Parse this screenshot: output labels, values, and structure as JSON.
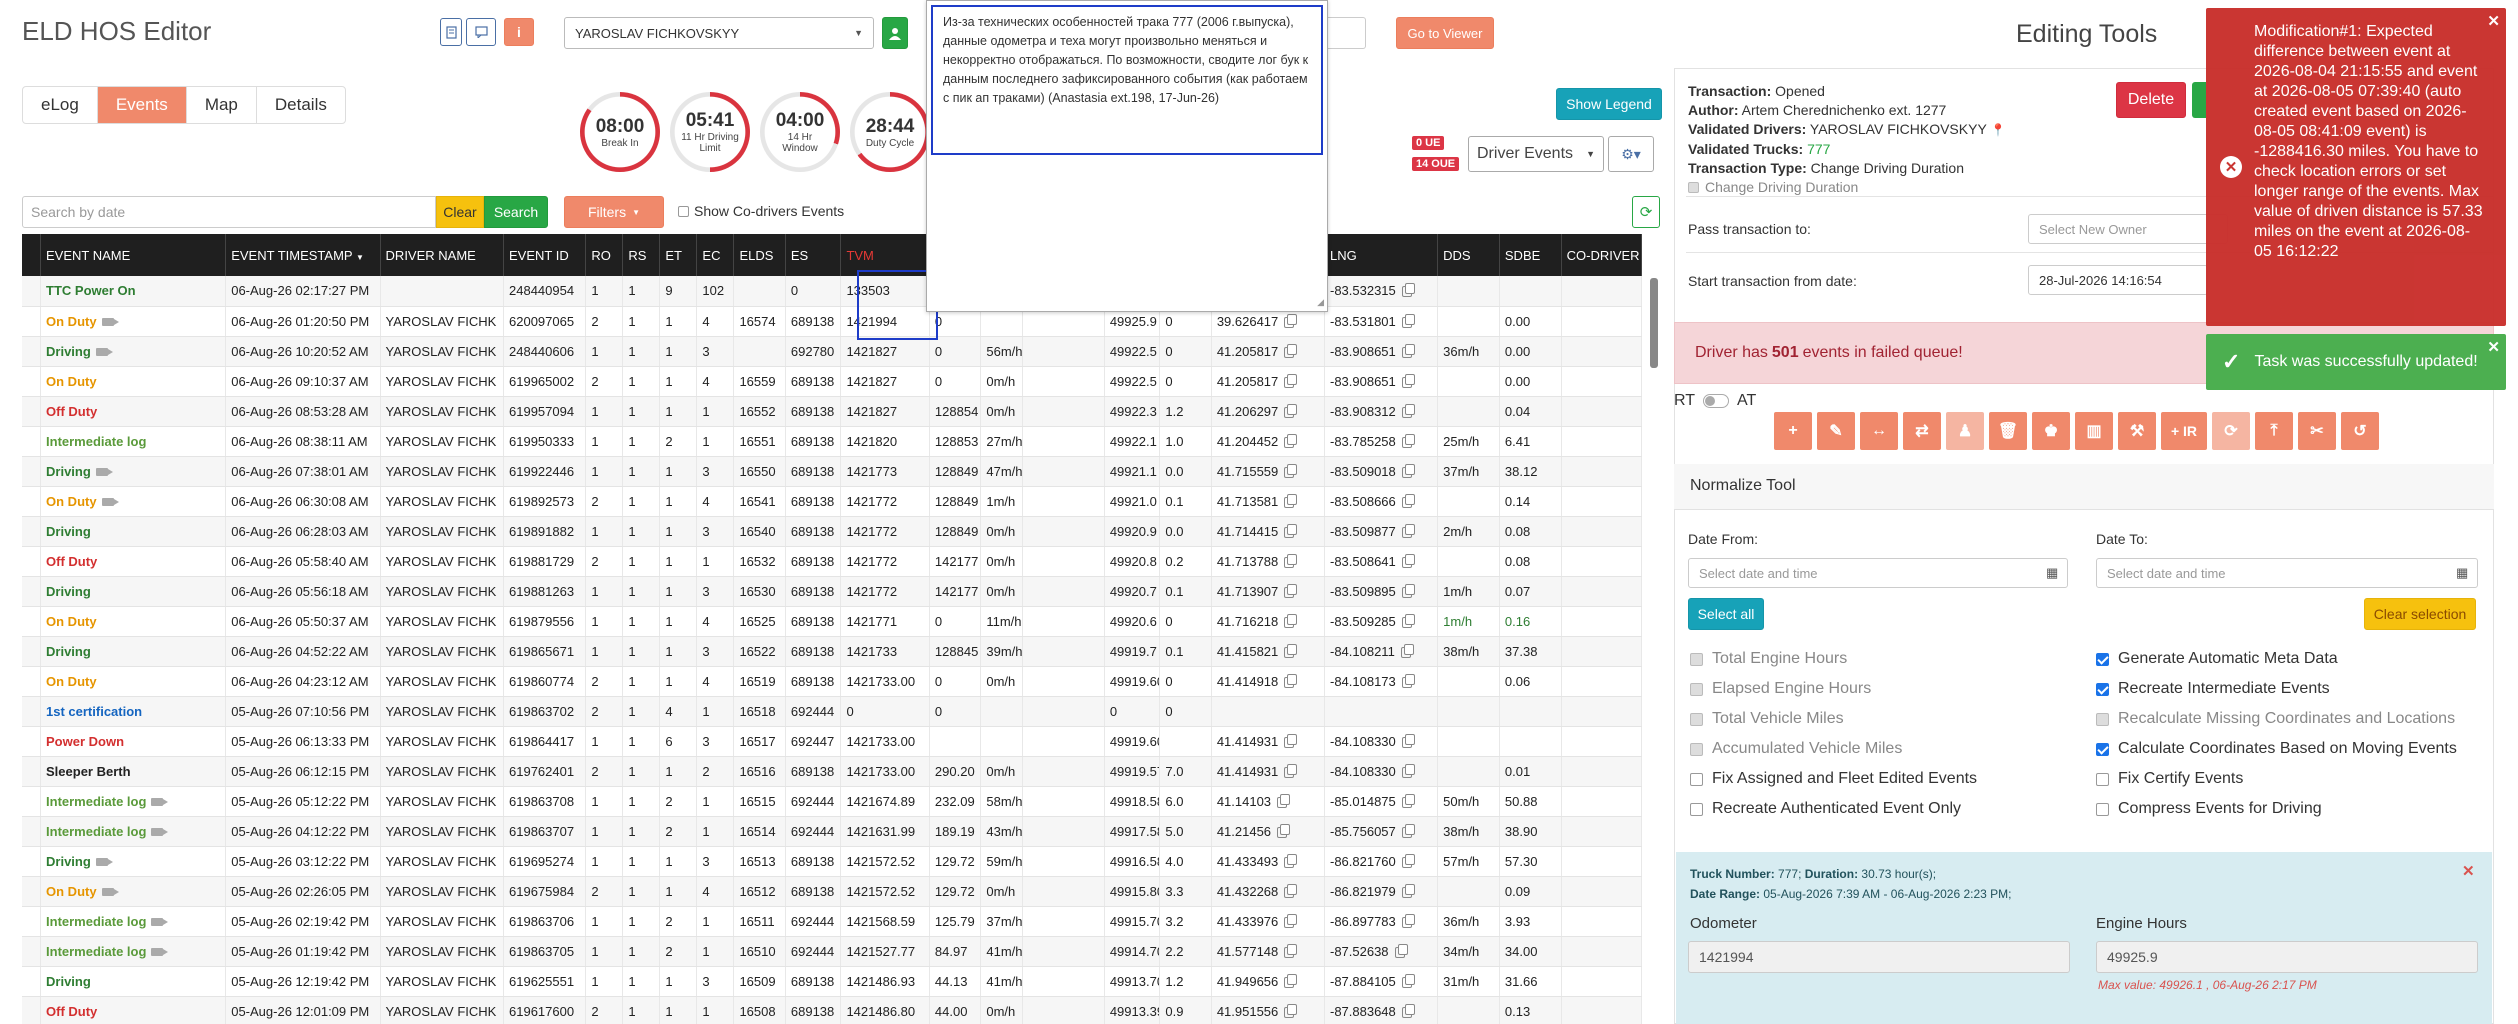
{
  "app": {
    "title": "ELD HOS Editor",
    "driver_select": "YAROSLAV FICHKOVSKYY",
    "go_to_viewer": "Go to Viewer"
  },
  "tabs": [
    {
      "label": "eLog"
    },
    {
      "label": "Events"
    },
    {
      "label": "Map"
    },
    {
      "label": "Details"
    }
  ],
  "gauges": [
    {
      "value": "08:00",
      "label": "Break In",
      "fraction": 0.85
    },
    {
      "value": "05:41",
      "label": "11 Hr Driving Limit",
      "fraction": 0.5
    },
    {
      "value": "04:00",
      "label": "14 Hr Window",
      "fraction": 0.3
    },
    {
      "value": "28:44",
      "label": "Duty Cycle",
      "fraction": 0.65
    }
  ],
  "toolbar": {
    "search_placeholder": "Search by date",
    "clear": "Clear",
    "search": "Search",
    "filters": "Filters",
    "show_codrivers": "Show Co-drivers Events",
    "show_legend": "Show Legend",
    "ue_badge": "0 UE",
    "oue_badge": "14 OUE",
    "driver_events": "Driver Events"
  },
  "table": {
    "headers": [
      "EVENT NAME",
      "EVENT TIMESTAMP",
      "DRIVER NAME",
      "EVENT ID",
      "RO",
      "RS",
      "ET",
      "EC",
      "ELDS",
      "ES",
      "TVM",
      "",
      "",
      "",
      "",
      "",
      "LNG",
      "DDS",
      "SDBE",
      "CO-DRIVER"
    ],
    "rows": [
      {
        "name": "TTC Power On",
        "color": "#2e7d32",
        "ts": "06-Aug-26 02:17:27 PM",
        "driver": "",
        "id": "248440954",
        "ro": "1",
        "rs": "1",
        "et": "9",
        "ec": "102",
        "elds": "",
        "es": "0",
        "tvm": "133503",
        "c1": "",
        "c2": "",
        "eh": "",
        "c4": "",
        "lat": "",
        "lng": "-83.532315",
        "dds": "",
        "sdbe": "",
        "cam": false
      },
      {
        "name": "On Duty",
        "color": "#e69500",
        "ts": "06-Aug-26 01:20:50 PM",
        "driver": "YAROSLAV FICHK",
        "id": "620097065",
        "ro": "2",
        "rs": "1",
        "et": "1",
        "ec": "4",
        "elds": "16574",
        "es": "689138",
        "tvm": "1421994",
        "c1": "0",
        "c2": "",
        "eh": "49925.9",
        "c4": "0",
        "lat": "39.626417",
        "lng": "-83.531801",
        "dds": "",
        "sdbe": "0.00",
        "cam": true
      },
      {
        "name": "Driving",
        "color": "#2e7d32",
        "ts": "06-Aug-26 10:20:52 AM",
        "driver": "YAROSLAV FICHK",
        "id": "248440606",
        "ro": "1",
        "rs": "1",
        "et": "1",
        "ec": "3",
        "elds": "",
        "es": "692780",
        "tvm": "1421827",
        "c1": "0",
        "c2": "56m/h",
        "eh": "49922.5",
        "c4": "0",
        "lat": "41.205817",
        "lng": "-83.908651",
        "dds": "36m/h",
        "sdbe": "0.00",
        "cam": true
      },
      {
        "name": "On Duty",
        "color": "#e69500",
        "ts": "06-Aug-26 09:10:37 AM",
        "driver": "YAROSLAV FICHK",
        "id": "619965002",
        "ro": "2",
        "rs": "1",
        "et": "1",
        "ec": "4",
        "elds": "16559",
        "es": "689138",
        "tvm": "1421827",
        "c1": "0",
        "c2": "0m/h",
        "eh": "49922.5",
        "c4": "0",
        "lat": "41.205817",
        "lng": "-83.908651",
        "dds": "",
        "sdbe": "0.00",
        "cam": false
      },
      {
        "name": "Off Duty",
        "color": "#d32f2f",
        "ts": "06-Aug-26 08:53:28 AM",
        "driver": "YAROSLAV FICHK",
        "id": "619957094",
        "ro": "1",
        "rs": "1",
        "et": "1",
        "ec": "1",
        "elds": "16552",
        "es": "689138",
        "tvm": "1421827",
        "c1": "128854",
        "c2": "0m/h",
        "eh": "49922.3",
        "c4": "1.2",
        "lat": "41.206297",
        "lng": "-83.908312",
        "dds": "",
        "sdbe": "0.04",
        "cam": false
      },
      {
        "name": "Intermediate log",
        "color": "#5a9a3a",
        "ts": "06-Aug-26 08:38:11 AM",
        "driver": "YAROSLAV FICHK",
        "id": "619950333",
        "ro": "1",
        "rs": "1",
        "et": "2",
        "ec": "1",
        "elds": "16551",
        "es": "689138",
        "tvm": "1421820",
        "c1": "128853",
        "c2": "27m/h",
        "eh": "49922.1",
        "c4": "1.0",
        "lat": "41.204452",
        "lng": "-83.785258",
        "dds": "25m/h",
        "sdbe": "6.41",
        "cam": false
      },
      {
        "name": "Driving",
        "color": "#2e7d32",
        "ts": "06-Aug-26 07:38:01 AM",
        "driver": "YAROSLAV FICHK",
        "id": "619922446",
        "ro": "1",
        "rs": "1",
        "et": "1",
        "ec": "3",
        "elds": "16550",
        "es": "689138",
        "tvm": "1421773",
        "c1": "128849",
        "c2": "47m/h",
        "eh": "49921.1",
        "c4": "0.0",
        "lat": "41.715559",
        "lng": "-83.509018",
        "dds": "37m/h",
        "sdbe": "38.12",
        "cam": true
      },
      {
        "name": "On Duty",
        "color": "#e69500",
        "ts": "06-Aug-26 06:30:08 AM",
        "driver": "YAROSLAV FICHK",
        "id": "619892573",
        "ro": "2",
        "rs": "1",
        "et": "1",
        "ec": "4",
        "elds": "16541",
        "es": "689138",
        "tvm": "1421772",
        "c1": "128849",
        "c2": "1m/h",
        "eh": "49921.0",
        "c4": "0.1",
        "lat": "41.713581",
        "lng": "-83.508666",
        "dds": "",
        "sdbe": "0.14",
        "cam": true
      },
      {
        "name": "Driving",
        "color": "#2e7d32",
        "ts": "06-Aug-26 06:28:03 AM",
        "driver": "YAROSLAV FICHK",
        "id": "619891882",
        "ro": "1",
        "rs": "1",
        "et": "1",
        "ec": "3",
        "elds": "16540",
        "es": "689138",
        "tvm": "1421772",
        "c1": "128849",
        "c2": "0m/h",
        "eh": "49920.9",
        "c4": "0.0",
        "lat": "41.714415",
        "lng": "-83.509877",
        "dds": "2m/h",
        "sdbe": "0.08",
        "cam": false
      },
      {
        "name": "Off Duty",
        "color": "#d32f2f",
        "ts": "06-Aug-26 05:58:40 AM",
        "driver": "YAROSLAV FICHK",
        "id": "619881729",
        "ro": "2",
        "rs": "1",
        "et": "1",
        "ec": "1",
        "elds": "16532",
        "es": "689138",
        "tvm": "1421772",
        "c1": "142177",
        "c2": "0m/h",
        "eh": "49920.8",
        "c4": "0.2",
        "lat": "41.713788",
        "lng": "-83.508641",
        "dds": "",
        "sdbe": "0.08",
        "cam": false
      },
      {
        "name": "Driving",
        "color": "#2e7d32",
        "ts": "06-Aug-26 05:56:18 AM",
        "driver": "YAROSLAV FICHK",
        "id": "619881263",
        "ro": "1",
        "rs": "1",
        "et": "1",
        "ec": "3",
        "elds": "16530",
        "es": "689138",
        "tvm": "1421772",
        "c1": "142177",
        "c2": "0m/h",
        "eh": "49920.7",
        "c4": "0.1",
        "lat": "41.713907",
        "lng": "-83.509895",
        "dds": "1m/h",
        "sdbe": "0.07",
        "cam": false
      },
      {
        "name": "On Duty",
        "color": "#e69500",
        "ts": "06-Aug-26 05:50:37 AM",
        "driver": "YAROSLAV FICHK",
        "id": "619879556",
        "ro": "1",
        "rs": "1",
        "et": "1",
        "ec": "4",
        "elds": "16525",
        "es": "689138",
        "tvm": "1421771",
        "c1": "0",
        "c2": "11m/h",
        "eh": "49920.6",
        "c4": "0",
        "lat": "41.716218",
        "lng": "-83.509285",
        "dds": "1m/h",
        "sdbe": "0.16",
        "cam": false
      },
      {
        "name": "Driving",
        "color": "#2e7d32",
        "ts": "06-Aug-26 04:52:22 AM",
        "driver": "YAROSLAV FICHK",
        "id": "619865671",
        "ro": "1",
        "rs": "1",
        "et": "1",
        "ec": "3",
        "elds": "16522",
        "es": "689138",
        "tvm": "1421733",
        "c1": "128845",
        "c2": "39m/h",
        "eh": "49919.7",
        "c4": "0.1",
        "lat": "41.415821",
        "lng": "-84.108211",
        "dds": "38m/h",
        "sdbe": "37.38",
        "cam": false
      },
      {
        "name": "On Duty",
        "color": "#e69500",
        "ts": "06-Aug-26 04:23:12 AM",
        "driver": "YAROSLAV FICHK",
        "id": "619860774",
        "ro": "2",
        "rs": "1",
        "et": "1",
        "ec": "4",
        "elds": "16519",
        "es": "689138",
        "tvm": "1421733.00",
        "c1": "0",
        "c2": "0m/h",
        "eh": "49919.60",
        "c4": "0",
        "lat": "41.414918",
        "lng": "-84.108173",
        "dds": "",
        "sdbe": "0.06",
        "cam": false
      },
      {
        "name": "1st certification",
        "color": "#1565c0",
        "ts": "05-Aug-26 07:10:56 PM",
        "driver": "YAROSLAV FICHK",
        "id": "619863702",
        "ro": "2",
        "rs": "1",
        "et": "4",
        "ec": "1",
        "elds": "16518",
        "es": "692444",
        "tvm": "0",
        "c1": "0",
        "c2": "",
        "eh": "0",
        "c4": "0",
        "lat": "",
        "lng": "",
        "dds": "",
        "sdbe": "",
        "cam": false
      },
      {
        "name": "Power Down",
        "color": "#d32f2f",
        "ts": "05-Aug-26 06:13:33 PM",
        "driver": "YAROSLAV FICHK",
        "id": "619864417",
        "ro": "1",
        "rs": "1",
        "et": "6",
        "ec": "3",
        "elds": "16517",
        "es": "692447",
        "tvm": "1421733.00",
        "c1": "",
        "c2": "",
        "eh": "49919.60",
        "c4": "",
        "lat": "41.414931",
        "lng": "-84.108330",
        "dds": "",
        "sdbe": "",
        "cam": false
      },
      {
        "name": "Sleeper Berth",
        "color": "#222222",
        "ts": "05-Aug-26 06:12:15 PM",
        "driver": "YAROSLAV FICHK",
        "id": "619762401",
        "ro": "2",
        "rs": "1",
        "et": "1",
        "ec": "2",
        "elds": "16516",
        "es": "689138",
        "tvm": "1421733.00",
        "c1": "290.20",
        "c2": "0m/h",
        "eh": "49919.57",
        "c4": "7.0",
        "lat": "41.414931",
        "lng": "-84.108330",
        "dds": "",
        "sdbe": "0.01",
        "cam": false
      },
      {
        "name": "Intermediate log",
        "color": "#5a9a3a",
        "ts": "05-Aug-26 05:12:22 PM",
        "driver": "YAROSLAV FICHK",
        "id": "619863708",
        "ro": "1",
        "rs": "1",
        "et": "2",
        "ec": "1",
        "elds": "16515",
        "es": "692444",
        "tvm": "1421674.89",
        "c1": "232.09",
        "c2": "58m/h",
        "eh": "49918.58",
        "c4": "6.0",
        "lat": "41.14103",
        "lng": "-85.014875",
        "dds": "50m/h",
        "sdbe": "50.88",
        "cam": true
      },
      {
        "name": "Intermediate log",
        "color": "#5a9a3a",
        "ts": "05-Aug-26 04:12:22 PM",
        "driver": "YAROSLAV FICHK",
        "id": "619863707",
        "ro": "1",
        "rs": "1",
        "et": "2",
        "ec": "1",
        "elds": "16514",
        "es": "692444",
        "tvm": "1421631.99",
        "c1": "189.19",
        "c2": "43m/h",
        "eh": "49917.58",
        "c4": "5.0",
        "lat": "41.21456",
        "lng": "-85.756057",
        "dds": "38m/h",
        "sdbe": "38.90",
        "cam": true
      },
      {
        "name": "Driving",
        "color": "#2e7d32",
        "ts": "05-Aug-26 03:12:22 PM",
        "driver": "YAROSLAV FICHK",
        "id": "619695274",
        "ro": "1",
        "rs": "1",
        "et": "1",
        "ec": "3",
        "elds": "16513",
        "es": "689138",
        "tvm": "1421572.52",
        "c1": "129.72",
        "c2": "59m/h",
        "eh": "49916.58",
        "c4": "4.0",
        "lat": "41.433493",
        "lng": "-86.821760",
        "dds": "57m/h",
        "sdbe": "57.30",
        "cam": true
      },
      {
        "name": "On Duty",
        "color": "#e69500",
        "ts": "05-Aug-26 02:26:05 PM",
        "driver": "YAROSLAV FICHK",
        "id": "619675984",
        "ro": "2",
        "rs": "1",
        "et": "1",
        "ec": "4",
        "elds": "16512",
        "es": "689138",
        "tvm": "1421572.52",
        "c1": "129.72",
        "c2": "0m/h",
        "eh": "49915.80",
        "c4": "3.3",
        "lat": "41.432268",
        "lng": "-86.821979",
        "dds": "",
        "sdbe": "0.09",
        "cam": true
      },
      {
        "name": "Intermediate log",
        "color": "#5a9a3a",
        "ts": "05-Aug-26 02:19:42 PM",
        "driver": "YAROSLAV FICHK",
        "id": "619863706",
        "ro": "1",
        "rs": "1",
        "et": "2",
        "ec": "1",
        "elds": "16511",
        "es": "692444",
        "tvm": "1421568.59",
        "c1": "125.79",
        "c2": "37m/h",
        "eh": "49915.70",
        "c4": "3.2",
        "lat": "41.433976",
        "lng": "-86.897783",
        "dds": "36m/h",
        "sdbe": "3.93",
        "cam": true
      },
      {
        "name": "Intermediate log",
        "color": "#5a9a3a",
        "ts": "05-Aug-26 01:19:42 PM",
        "driver": "YAROSLAV FICHK",
        "id": "619863705",
        "ro": "1",
        "rs": "1",
        "et": "2",
        "ec": "1",
        "elds": "16510",
        "es": "692444",
        "tvm": "1421527.77",
        "c1": "84.97",
        "c2": "41m/h",
        "eh": "49914.70",
        "c4": "2.2",
        "lat": "41.577148",
        "lng": "-87.52638",
        "dds": "34m/h",
        "sdbe": "34.00",
        "cam": true
      },
      {
        "name": "Driving",
        "color": "#2e7d32",
        "ts": "05-Aug-26 12:19:42 PM",
        "driver": "YAROSLAV FICHK",
        "id": "619625551",
        "ro": "1",
        "rs": "1",
        "et": "1",
        "ec": "3",
        "elds": "16509",
        "es": "689138",
        "tvm": "1421486.93",
        "c1": "44.13",
        "c2": "41m/h",
        "eh": "49913.70",
        "c4": "1.2",
        "lat": "41.949656",
        "lng": "-87.884105",
        "dds": "31m/h",
        "sdbe": "31.66",
        "cam": false
      },
      {
        "name": "Off Duty",
        "color": "#d32f2f",
        "ts": "05-Aug-26 12:01:09 PM",
        "driver": "YAROSLAV FICHK",
        "id": "619617600",
        "ro": "2",
        "rs": "1",
        "et": "1",
        "ec": "1",
        "elds": "16508",
        "es": "689138",
        "tvm": "1421486.80",
        "c1": "44.00",
        "c2": "0m/h",
        "eh": "49913.39",
        "c4": "0.9",
        "lat": "41.951556",
        "lng": "-87.883648",
        "dds": "",
        "sdbe": "0.13",
        "cam": false
      }
    ]
  },
  "note_popup": {
    "text": "Из-за технических особенностей трака  777 (2006 г.выпуска), данные одометра и теха могут произвольно меняться и некорректно отображаться. По возможности, сводите лог бук к данным последнего зафиксированного события (как работаем с пик ап траками)  (Anastasia ext.198, 17-Jun-26)"
  },
  "editing": {
    "title": "Editing Tools",
    "transaction_label": "Transaction:",
    "transaction": "Opened",
    "author_label": "Author:",
    "author": "Artem Cherednichenko ext. 1277",
    "validated_drivers_label": "Validated Drivers:",
    "validated_drivers": "YAROSLAV FICHKOVSKYY",
    "validated_trucks_label": "Validated Trucks:",
    "validated_trucks": "777",
    "transaction_type_label": "Transaction Type:",
    "transaction_type": "Change Driving Duration",
    "change_driving_duration": "Change Driving Duration",
    "delete": "Delete",
    "pass_to_label": "Pass transaction to:",
    "pass_to_placeholder": "Select New Owner",
    "start_from_label": "Start transaction from date:",
    "start_from_value": "28-Jul-2026 14:16:54",
    "failed_queue_prefix": "Driver has ",
    "failed_queue_count": "501",
    "failed_queue_suffix": " events in failed queue!",
    "rt": "RT",
    "at": "AT"
  },
  "normalize": {
    "title": "Normalize Tool",
    "date_from": "Date From:",
    "date_to": "Date To:",
    "date_placeholder": "Select date and time",
    "select_all": "Select all",
    "clear_selection": "Clear selection",
    "left_options": [
      {
        "label": "Total Engine Hours",
        "state": "dis"
      },
      {
        "label": "Elapsed Engine Hours",
        "state": "dis"
      },
      {
        "label": "Total Vehicle Miles",
        "state": "dis"
      },
      {
        "label": "Accumulated Vehicle Miles",
        "state": "dis"
      },
      {
        "label": "Fix Assigned and Fleet Edited Events",
        "state": "off"
      },
      {
        "label": "Recreate Authenticated Event Only",
        "state": "off"
      }
    ],
    "right_options": [
      {
        "label": "Generate Automatic Meta Data",
        "state": "on"
      },
      {
        "label": "Recreate Intermediate Events",
        "state": "on"
      },
      {
        "label": "Recalculate Missing Coordinates and Locations",
        "state": "dis"
      },
      {
        "label": "Calculate Coordinates Based on Moving Events",
        "state": "on"
      },
      {
        "label": "Fix Certify Events",
        "state": "off"
      },
      {
        "label": "Compress Events for Driving",
        "state": "off"
      }
    ]
  },
  "truck_info": {
    "truck_number_label": "Truck Number:",
    "truck_number": "777",
    "duration_label": "Duration:",
    "duration": "30.73 hour(s);",
    "date_range_label": "Date Range:",
    "date_range": "05-Aug-2026 7:39 AM - 06-Aug-2026 2:23 PM;",
    "odometer_label": "Odometer",
    "odometer": "1421994",
    "engine_hours_label": "Engine Hours",
    "engine_hours": "49925.9",
    "max_value": "Max value: 49926.1 , 06-Aug-26 2:17 PM"
  },
  "toasts": {
    "error": "Modification#1: Expected difference between event at 2026-08-04 21:15:55 and event at 2026-08-05 07:39:40 (auto created event based on 2026-08-05 08:41:09 event) is -1288416.30 miles. You have to check location errors or set longer range of the events. Max value of driven distance is 57.33 miles on the event at 2026-08-05 16:12:22",
    "success": "Task was successfully updated!"
  },
  "colors": {
    "accent": "#f0896b",
    "error_toast": "#c9302c",
    "success_toast": "#4caf50"
  }
}
